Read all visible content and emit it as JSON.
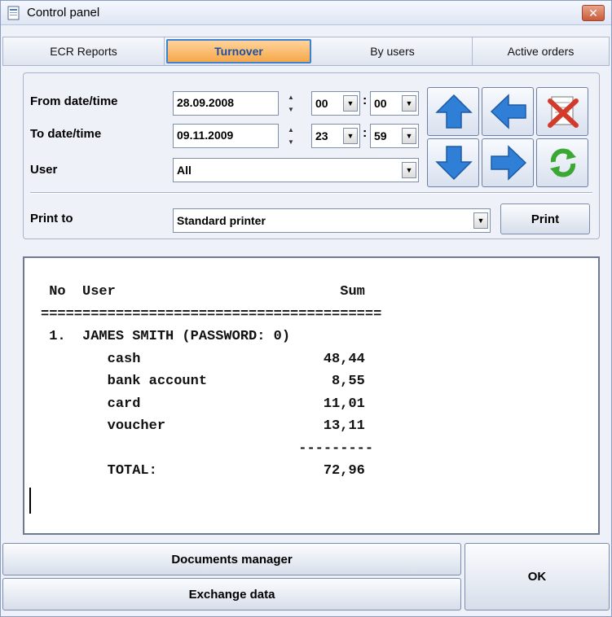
{
  "window": {
    "title": "Control panel",
    "close_label": "✕"
  },
  "tabs": [
    {
      "label": "ECR Reports"
    },
    {
      "label": "Turnover"
    },
    {
      "label": "By users"
    },
    {
      "label": "Active orders"
    }
  ],
  "filter": {
    "from_label": "From date/time",
    "from_date": "28.09.2008",
    "from_hour": "00",
    "from_minute": "00",
    "to_label": "To date/time",
    "to_date": "09.11.2009",
    "to_hour": "23",
    "to_minute": "59",
    "user_label": "User",
    "user_value": "All",
    "print_to_label": "Print to",
    "print_to_value": "Standard printer",
    "print_button": "Print",
    "colon": ":"
  },
  "report": {
    "lines": [
      " No  User                           Sum",
      "=========================================",
      " 1.  JAMES SMITH (PASSWORD: 0)",
      "        cash                      48,44",
      "        bank account               8,55",
      "        card                      11,01",
      "        voucher                   13,11",
      "                               ---------",
      "        TOTAL:                    72,96"
    ]
  },
  "footer": {
    "documents_manager": "Documents manager",
    "exchange_data": "Exchange data",
    "ok": "OK"
  },
  "icons": {
    "up": "arrow-up-icon",
    "left": "arrow-left-icon",
    "delete": "delete-icon",
    "down": "arrow-down-icon",
    "right": "arrow-right-icon",
    "refresh": "refresh-icon"
  },
  "colors": {
    "active_tab": "#f6a84a",
    "arrows": "#2f7fd6",
    "refresh": "#3aa832",
    "delete": "#d23b2b"
  }
}
